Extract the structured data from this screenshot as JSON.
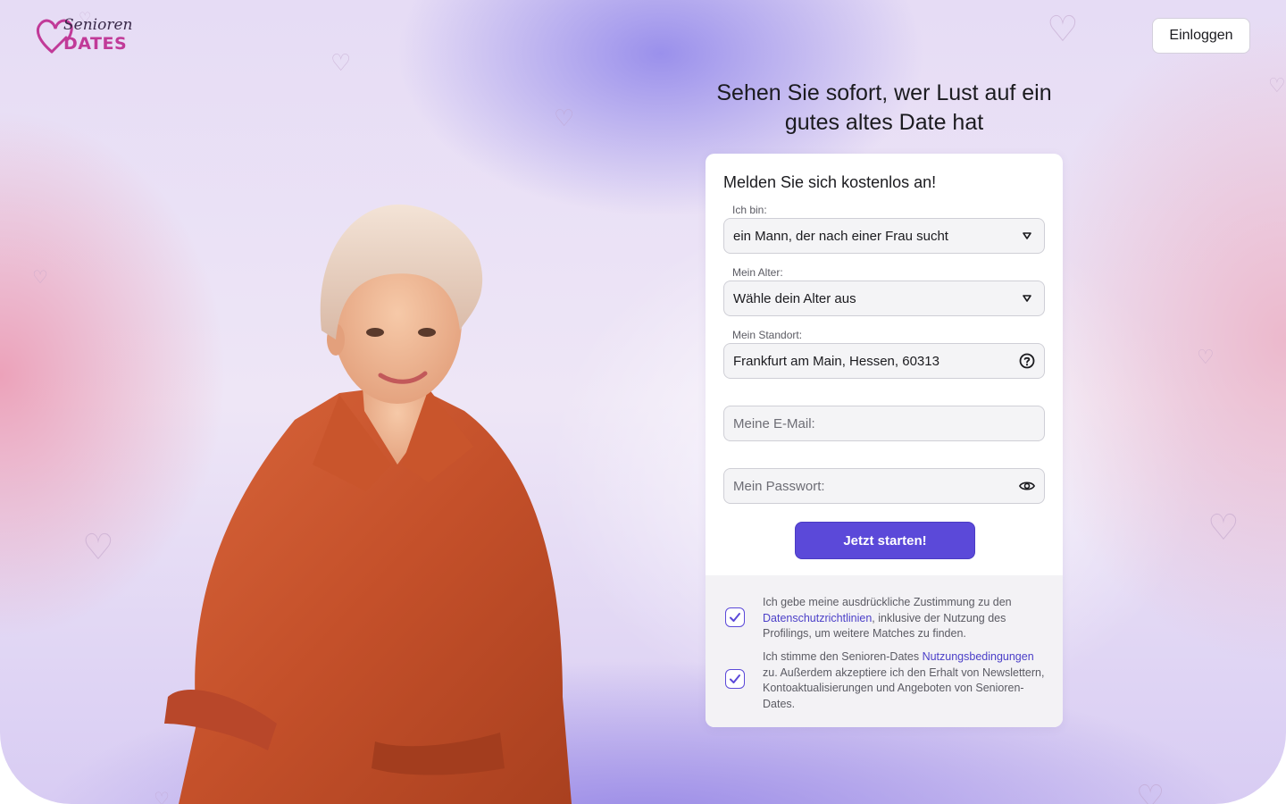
{
  "brand": {
    "logo_line1": "Senioren",
    "logo_line2": "DATES",
    "logo_color": "#c13a98"
  },
  "header": {
    "login_label": "Einloggen"
  },
  "hero": {
    "headline": "Sehen Sie sofort, wer Lust auf ein gutes altes Date hat"
  },
  "form": {
    "title": "Melden Sie sich kostenlos an!",
    "iam_label": "Ich bin:",
    "iam_value": "ein Mann, der nach einer Frau sucht",
    "age_label": "Mein Alter:",
    "age_value": "Wähle dein Alter aus",
    "location_label": "Mein Standort:",
    "location_value": "Frankfurt am Main, Hessen, 60313",
    "email_placeholder": "Meine E-Mail:",
    "password_placeholder": "Mein Passwort:",
    "submit_label": "Jetzt starten!",
    "accent_color": "#5b49d9"
  },
  "consents": [
    {
      "checked": true,
      "text_before": "Ich gebe meine ausdrückliche Zustimmung zu den ",
      "link": "Datenschutzrichtlinien",
      "text_after": ", inklusive der Nutzung des Profilings, um weitere Matches zu finden."
    },
    {
      "checked": true,
      "text_before": "Ich stimme den Senioren-Dates ",
      "link": "Nutzungsbedingungen",
      "text_after": " zu. Außerdem akzeptiere ich den Erhalt von Newslettern, Kontoaktualisierungen und Angeboten von Senioren-Dates."
    }
  ],
  "icons": {
    "iam_caret": "caret-down-icon",
    "age_caret": "caret-down-icon",
    "location_help": "question-circle-icon",
    "password_toggle": "eye-icon",
    "checkbox": "checkmark-icon",
    "decor": "heart-outline-icon"
  }
}
